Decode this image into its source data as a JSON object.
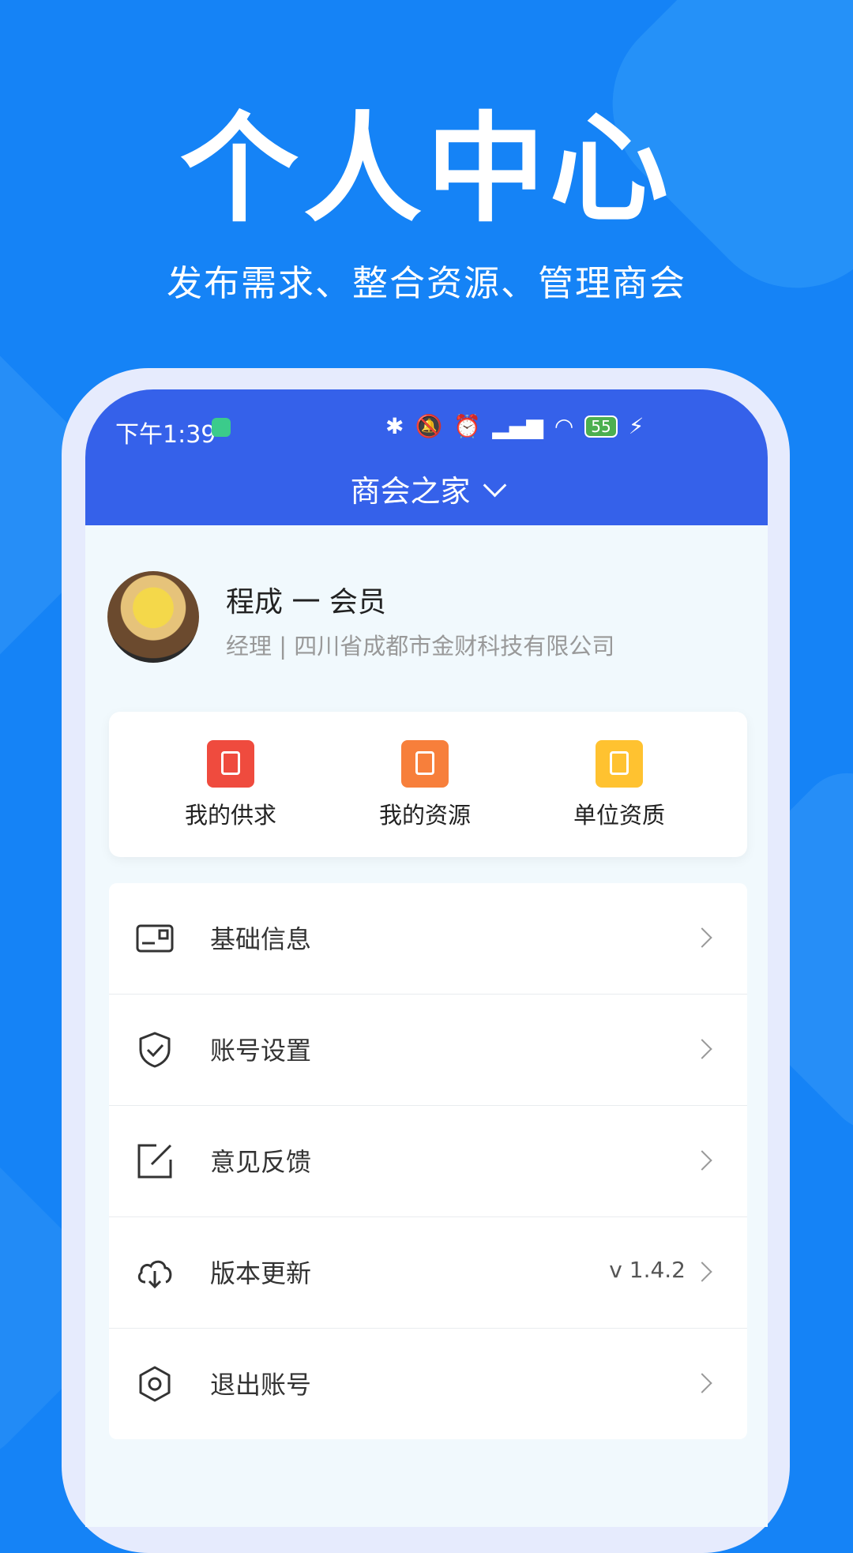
{
  "hero": {
    "title": "个人中心",
    "subtitle": "发布需求、整合资源、管理商会"
  },
  "status_bar": {
    "time": "下午1:39",
    "battery": "55",
    "icons": [
      "bluetooth-icon",
      "mute-icon",
      "alarm-icon",
      "signal-icon",
      "wifi-icon",
      "battery-icon",
      "charging-icon"
    ]
  },
  "header": {
    "title": "商会之家"
  },
  "profile": {
    "name": "程成 一 会员",
    "subtitle": "经理 | 四川省成都市金财科技有限公司"
  },
  "quick_actions": [
    {
      "label": "我的供求",
      "icon": "supply-demand-icon",
      "color": "#EF4B3E"
    },
    {
      "label": "我的资源",
      "icon": "resource-icon",
      "color": "#F77F3B"
    },
    {
      "label": "单位资质",
      "icon": "certificate-icon",
      "color": "#FFC230"
    }
  ],
  "menu": [
    {
      "label": "基础信息",
      "icon": "id-card-icon",
      "value": ""
    },
    {
      "label": "账号设置",
      "icon": "shield-check-icon",
      "value": ""
    },
    {
      "label": "意见反馈",
      "icon": "edit-icon",
      "value": ""
    },
    {
      "label": "版本更新",
      "icon": "cloud-download-icon",
      "value": "v 1.4.2"
    },
    {
      "label": "退出账号",
      "icon": "hexagon-logout-icon",
      "value": ""
    }
  ],
  "colors": {
    "background": "#1583F6",
    "header": "#3561EA",
    "screen": "#F1F9FD"
  }
}
